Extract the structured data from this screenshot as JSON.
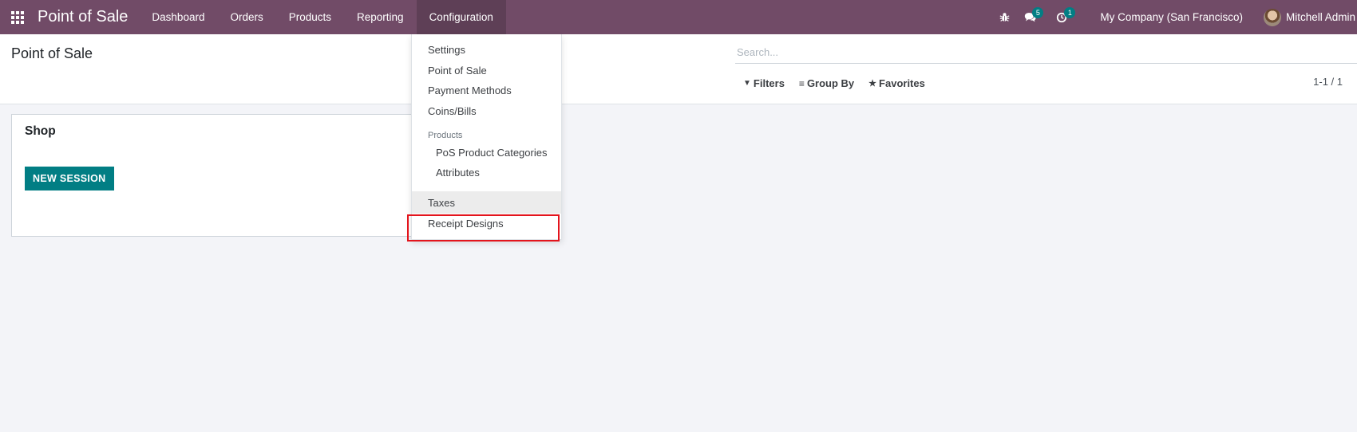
{
  "navbar": {
    "app_name": "Point of Sale",
    "menu": [
      "Dashboard",
      "Orders",
      "Products",
      "Reporting",
      "Configuration"
    ],
    "active_menu": "Configuration",
    "messages_badge": "5",
    "activities_badge": "1",
    "company": "My Company (San Francisco)",
    "user": "Mitchell Admin"
  },
  "control_panel": {
    "title": "Point of Sale",
    "search_placeholder": "Search...",
    "filters_label": "Filters",
    "group_by_label": "Group By",
    "favorites_label": "Favorites",
    "pager": "1-1 / 1"
  },
  "card": {
    "title": "Shop",
    "button_label": "NEW SESSION"
  },
  "config_dropdown": {
    "settings": "Settings",
    "point_of_sale": "Point of Sale",
    "payment_methods": "Payment Methods",
    "coins_bills": "Coins/Bills",
    "products_header": "Products",
    "pos_product_categories": "PoS Product Categories",
    "attributes": "Attributes",
    "taxes": "Taxes",
    "receipt_designs": "Receipt Designs"
  },
  "colors": {
    "navbar": "#714b67",
    "primary_button": "#017e84",
    "highlight_box": "#e3141c"
  }
}
